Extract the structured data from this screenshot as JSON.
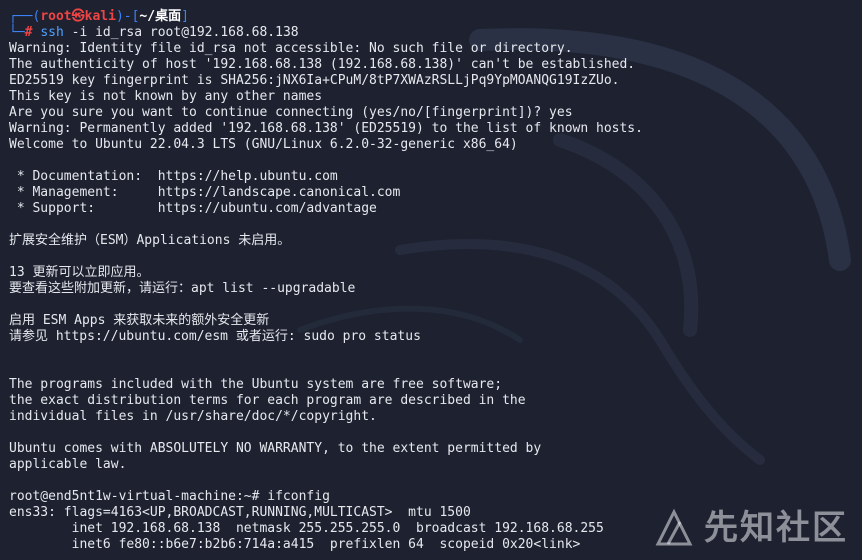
{
  "prompt": {
    "user_host": "root㉿kali",
    "dir": "~/桌面",
    "prefix_open": "┌──(",
    "prefix_mid": ")-[",
    "prefix_close": "]",
    "second_line": "└─",
    "hash": "#",
    "command": "ssh",
    "args": " -i id_rsa root@192.168.68.138"
  },
  "output_lines": [
    "Warning: Identity file id_rsa not accessible: No such file or directory.",
    "The authenticity of host '192.168.68.138 (192.168.68.138)' can't be established.",
    "ED25519 key fingerprint is SHA256:jNX6Ia+CPuM/8tP7XWAzRSLLjPq9YpMOANQG19IzZUo.",
    "This key is not known by any other names",
    "Are you sure you want to continue connecting (yes/no/[fingerprint])? yes",
    "Warning: Permanently added '192.168.68.138' (ED25519) to the list of known hosts.",
    "Welcome to Ubuntu 22.04.3 LTS (GNU/Linux 6.2.0-32-generic x86_64)",
    "",
    " * Documentation:  https://help.ubuntu.com",
    " * Management:     https://landscape.canonical.com",
    " * Support:        https://ubuntu.com/advantage",
    "",
    "扩展安全维护（ESM）Applications 未启用。",
    "",
    "13 更新可以立即应用。",
    "要查看这些附加更新，请运行：apt list --upgradable",
    "",
    "启用 ESM Apps 来获取未来的额外安全更新",
    "请参见 https://ubuntu.com/esm 或者运行: sudo pro status",
    "",
    "",
    "The programs included with the Ubuntu system are free software;",
    "the exact distribution terms for each program are described in the",
    "individual files in /usr/share/doc/*/copyright.",
    "",
    "Ubuntu comes with ABSOLUTELY NO WARRANTY, to the extent permitted by",
    "applicable law.",
    "",
    "root@end5nt1w-virtual-machine:~# ifconfig",
    "ens33: flags=4163<UP,BROADCAST,RUNNING,MULTICAST>  mtu 1500",
    "        inet 192.168.68.138  netmask 255.255.255.0  broadcast 192.168.68.255",
    "        inet6 fe80::b6e7:b2b6:714a:a415  prefixlen 64  scopeid 0x20<link>"
  ],
  "watermark": {
    "text": "先知社区",
    "icon": "xianzhi-logo-icon"
  },
  "colors": {
    "background": "#1e2230",
    "prompt_frame": "#3b82f6",
    "prompt_user": "#ef4444",
    "command": "#4ea1ff"
  }
}
